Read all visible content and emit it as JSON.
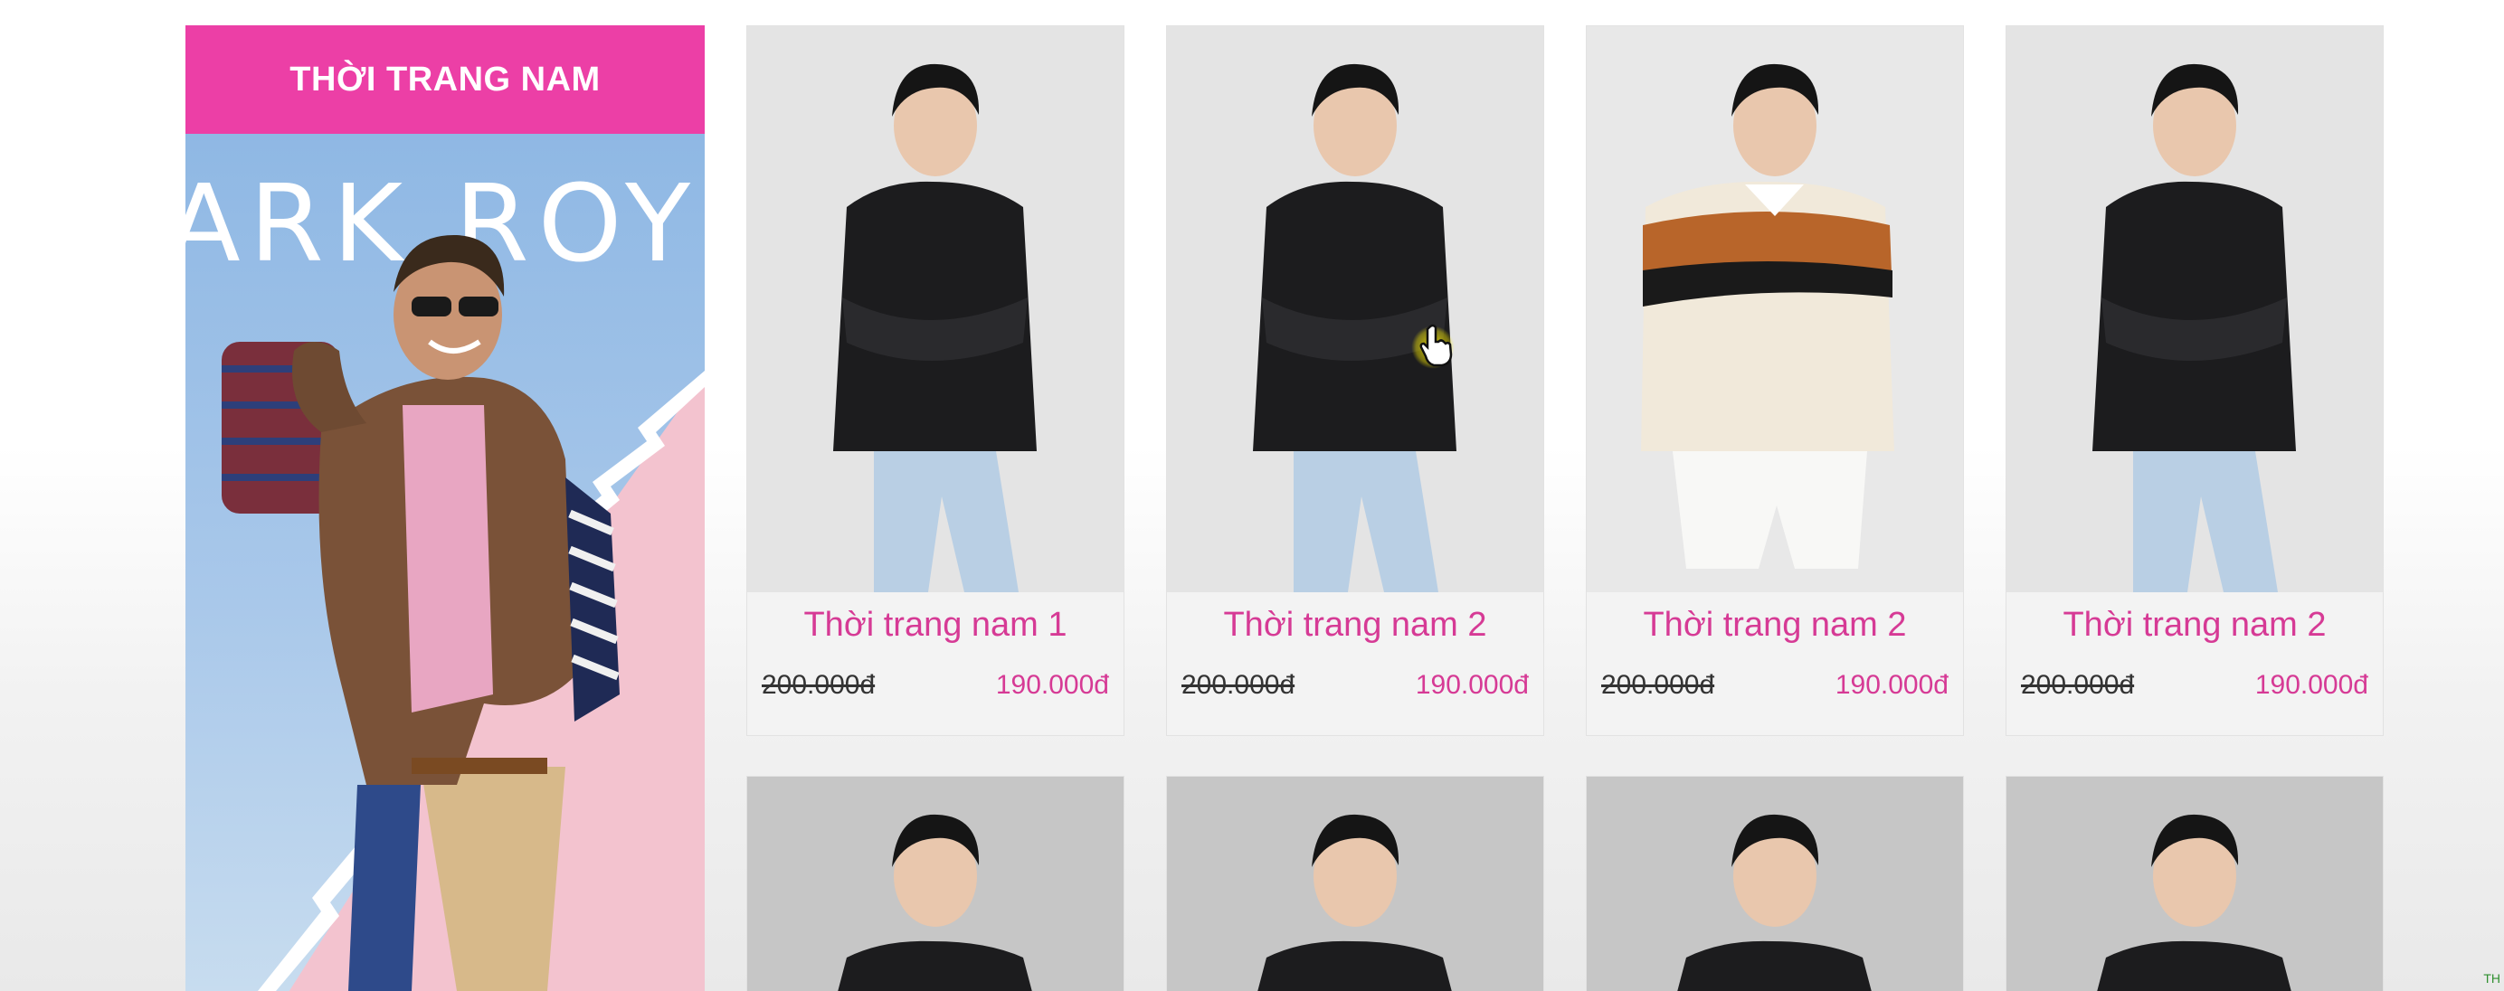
{
  "category": {
    "title": "THỜI TRANG NAM",
    "banner_brand": "ARK ROY",
    "header_color": "#ec3fa6"
  },
  "products": {
    "row1": [
      {
        "name": "Thời trang nam 1",
        "old_price": "200.000đ",
        "new_price": "190.000đ",
        "outfit": "black-sweater-jeans"
      },
      {
        "name": "Thời trang nam 2",
        "old_price": "200.000đ",
        "new_price": "190.000đ",
        "outfit": "black-sweater-jeans"
      },
      {
        "name": "Thời trang nam 2",
        "old_price": "200.000đ",
        "new_price": "190.000đ",
        "outfit": "striped-sweater-shorts"
      },
      {
        "name": "Thời trang nam 2",
        "old_price": "200.000đ",
        "new_price": "190.000đ",
        "outfit": "black-sweater-jeans"
      }
    ],
    "row2": [
      {
        "outfit": "black-sweater"
      },
      {
        "outfit": "black-sweater"
      },
      {
        "outfit": "black-sweater"
      },
      {
        "outfit": "black-sweater"
      }
    ]
  },
  "colors": {
    "accent": "#d63a95",
    "price_old": "#333333"
  },
  "corner_mark": "TH",
  "cursor_icon": "hand-pointer-icon"
}
